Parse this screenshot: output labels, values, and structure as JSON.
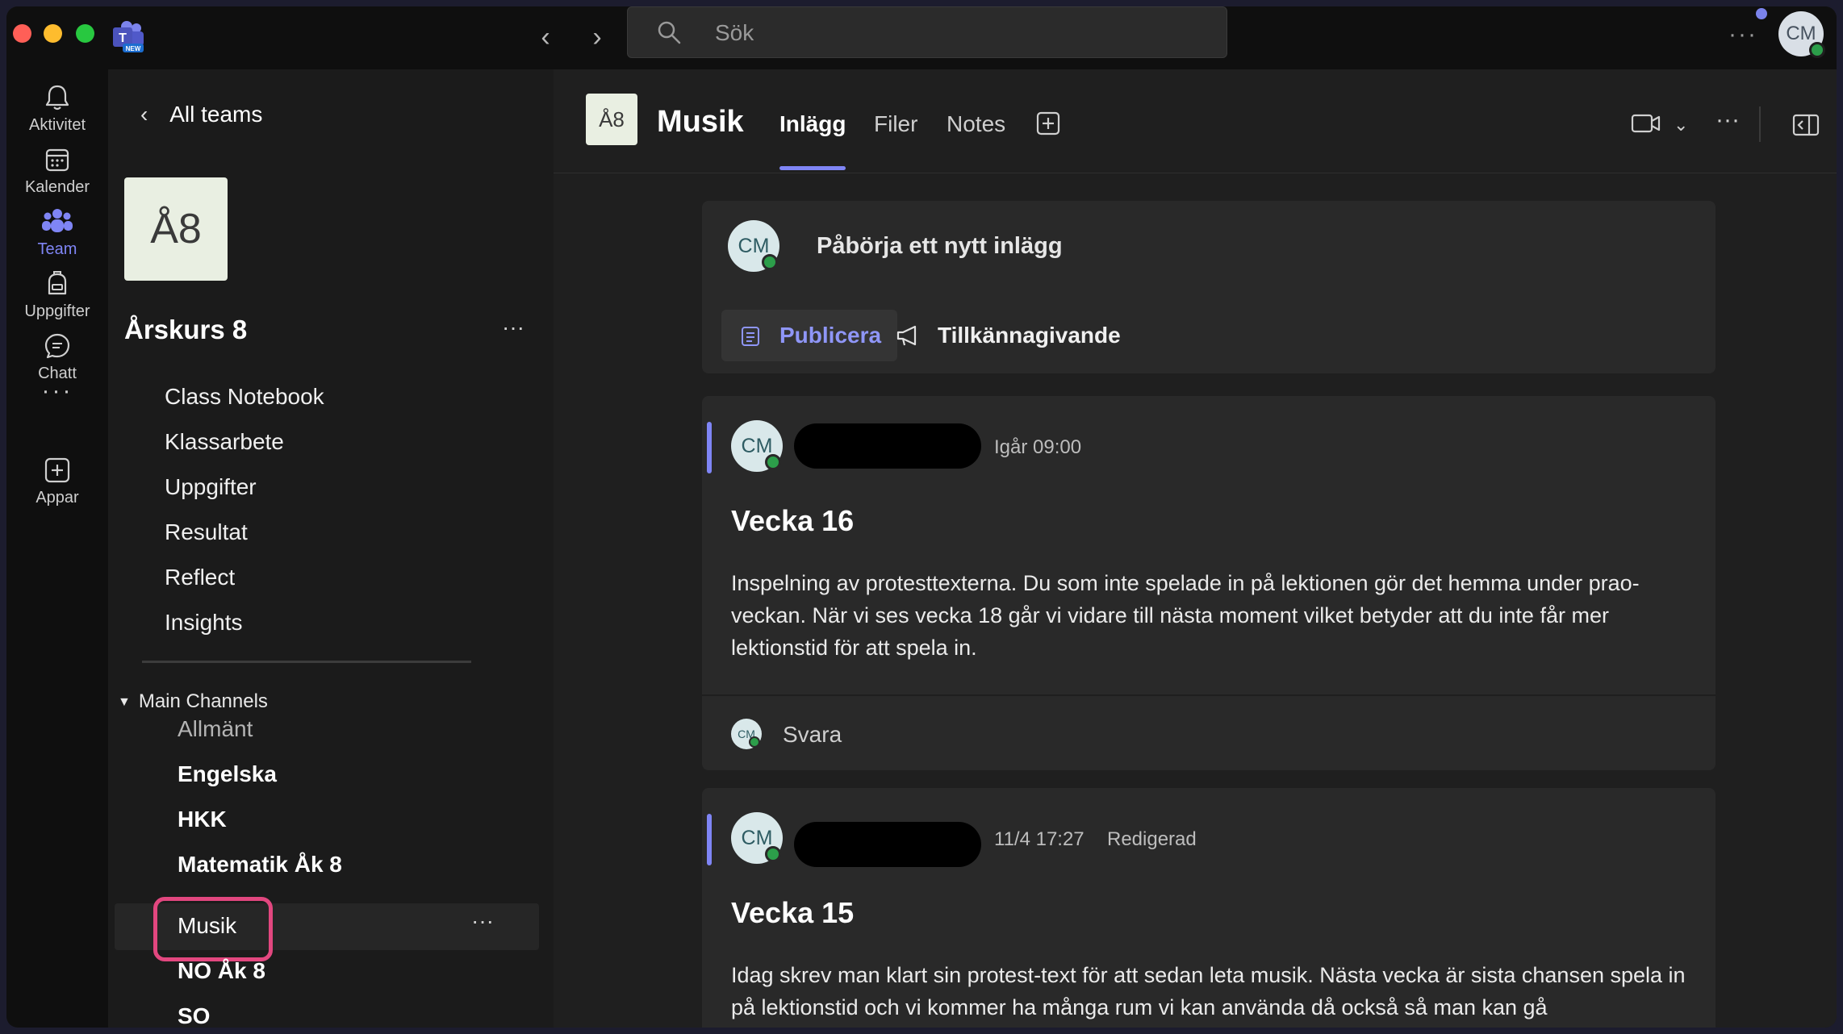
{
  "titlebar": {
    "search_placeholder": "Sök",
    "teams_logo_badge": "NEW",
    "user_initials": "CM"
  },
  "rail": {
    "items": [
      {
        "label": "Aktivitet",
        "icon": "bell-icon"
      },
      {
        "label": "Kalender",
        "icon": "calendar-icon"
      },
      {
        "label": "Team",
        "icon": "teams-icon",
        "active": true
      },
      {
        "label": "Uppgifter",
        "icon": "backpack-icon"
      },
      {
        "label": "Chatt",
        "icon": "chat-icon"
      },
      {
        "label": "Appar",
        "icon": "add-apps-icon"
      }
    ]
  },
  "teampane": {
    "back_label": "All teams",
    "team_tile": "Å8",
    "team_name": "Årskurs 8",
    "tabs": [
      "Class Notebook",
      "Klassarbete",
      "Uppgifter",
      "Resultat",
      "Reflect",
      "Insights"
    ],
    "section_label": "Main Channels",
    "channels": [
      {
        "name": "Allmänt",
        "style": "muted"
      },
      {
        "name": "Engelska",
        "style": "bold"
      },
      {
        "name": "HKK",
        "style": "bold"
      },
      {
        "name": "Matematik Åk 8",
        "style": "bold"
      },
      {
        "name": "Musik",
        "style": "active"
      },
      {
        "name": "NO Åk 8",
        "style": "bold"
      },
      {
        "name": "SO",
        "style": "bold"
      }
    ]
  },
  "header": {
    "tile": "Å8",
    "channel_title": "Musik",
    "tabs": [
      "Inlägg",
      "Filer",
      "Notes"
    ],
    "active_tab": "Inlägg"
  },
  "compose": {
    "avatar": "CM",
    "prompt": "Påbörja ett nytt inlägg",
    "publish_label": "Publicera",
    "announce_label": "Tillkännagivande"
  },
  "posts": [
    {
      "avatar": "CM",
      "time": "Igår 09:00",
      "edited": "",
      "title": "Vecka 16",
      "body": "Inspelning av protesttexterna. Du som inte spelade in på lektionen gör det hemma under prao-veckan. När vi ses vecka 18 går vi vidare till nästa moment vilket betyder att du inte får mer lektionstid för att spela in.",
      "reply_avatar": "CM",
      "reply_label": "Svara"
    },
    {
      "avatar": "CM",
      "time": "11/4 17:27",
      "edited": "Redigerad",
      "title": "Vecka 15",
      "body": "Idag skrev man klart sin protest-text för att sedan leta musik. Nästa vecka är sista chansen spela in på lektionstid och vi kommer ha många rum vi kan använda då också så man kan gå"
    }
  ],
  "colors": {
    "accent": "#7f85f5",
    "highlight": "#e2477f",
    "presence": "#2c9e4a"
  }
}
